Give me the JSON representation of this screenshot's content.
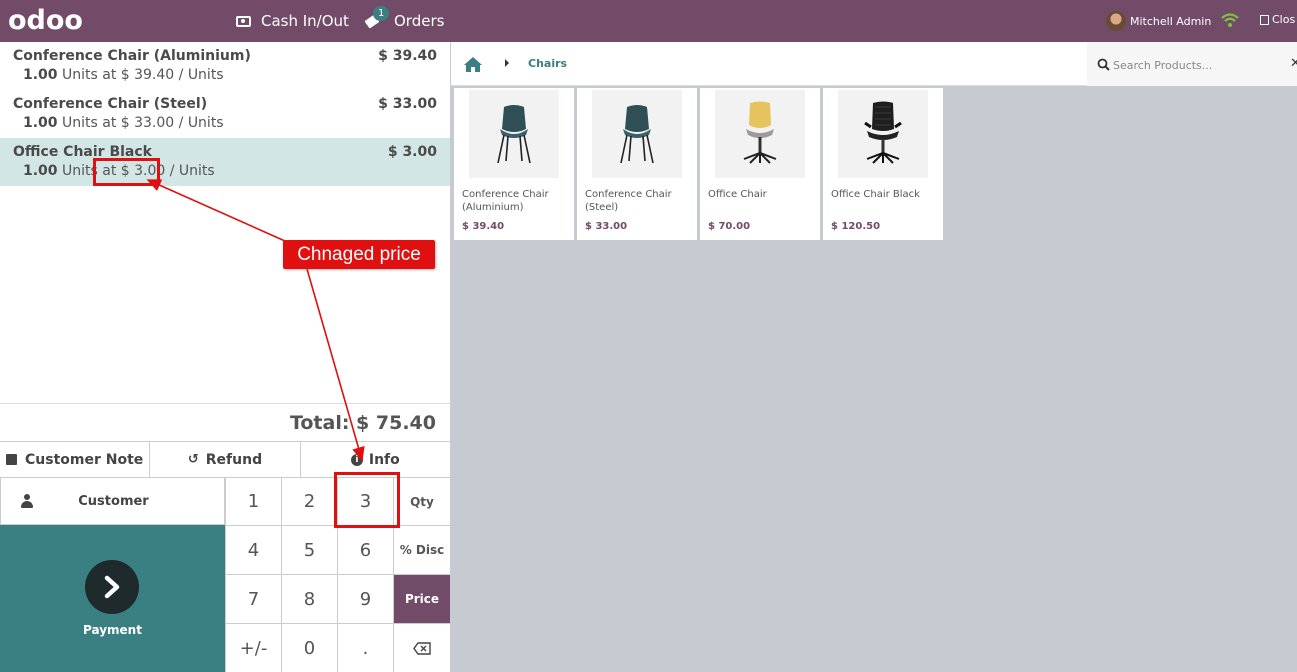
{
  "navbar": {
    "logo": "odoo",
    "cash_label": "Cash In/Out",
    "orders_label": "Orders",
    "orders_badge": "1",
    "user_name": "Mitchell Admin",
    "close_label": "Clos"
  },
  "order": {
    "lines": [
      {
        "name": "Conference Chair (Aluminium)",
        "price": "$ 39.40",
        "qty": "1.00",
        "info": " Units at $ 39.40 / Units"
      },
      {
        "name": "Conference Chair (Steel)",
        "price": "$ 33.00",
        "qty": "1.00",
        "info": " Units at $ 33.00 / Units"
      },
      {
        "name": "Office Chair Black",
        "price": "$ 3.00",
        "qty": "1.00",
        "info": " Units at $ 3.00 / Units"
      }
    ],
    "total": "Total: $ 75.40"
  },
  "controls": {
    "customer_note": "Customer Note",
    "refund": "Refund",
    "info": "Info",
    "customer": "Customer",
    "payment": "Payment"
  },
  "numpad": {
    "keys": [
      "1",
      "2",
      "3",
      "Qty",
      "4",
      "5",
      "6",
      "% Disc",
      "7",
      "8",
      "9",
      "Price",
      "+/-",
      "0",
      "."
    ],
    "active_mode": "Price"
  },
  "catalog": {
    "breadcrumb": "Chairs",
    "search_placeholder": "Search Products...",
    "products": [
      {
        "name": "Conference Chair (Aluminium)",
        "price": "$ 39.40"
      },
      {
        "name": "Conference Chair (Steel)",
        "price": "$ 33.00"
      },
      {
        "name": "Office Chair",
        "price": "$ 70.00"
      },
      {
        "name": "Office Chair Black",
        "price": "$ 120.50"
      }
    ]
  },
  "annotation": {
    "label": "Chnaged price"
  },
  "colors": {
    "brand": "#714b67",
    "accent": "#3a7f82",
    "selected_line": "#d2e6e6",
    "annotation": "#e01010"
  }
}
